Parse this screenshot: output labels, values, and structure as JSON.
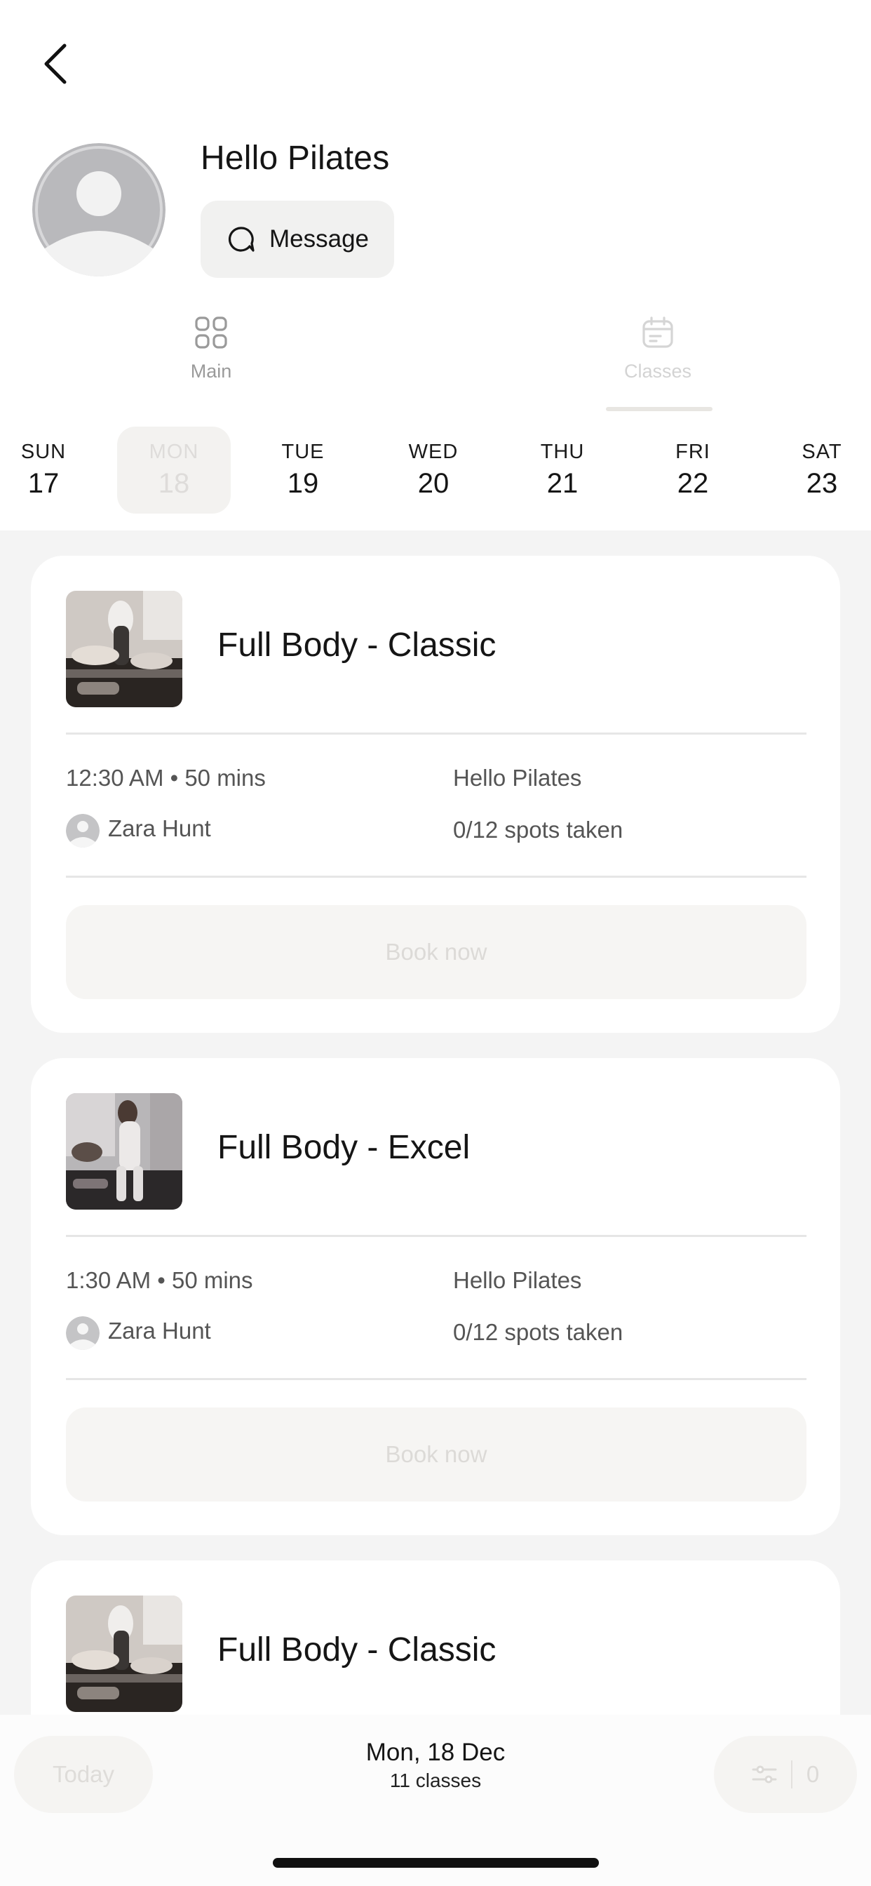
{
  "header": {
    "studio_name": "Hello Pilates",
    "message_label": "Message"
  },
  "tabs": [
    {
      "label": "Main",
      "icon": "grid-icon",
      "active": false
    },
    {
      "label": "Classes",
      "icon": "calendar-icon",
      "active": true
    }
  ],
  "days": [
    {
      "name": "SUN",
      "date": "17",
      "selected": false
    },
    {
      "name": "MON",
      "date": "18",
      "selected": true
    },
    {
      "name": "TUE",
      "date": "19",
      "selected": false
    },
    {
      "name": "WED",
      "date": "20",
      "selected": false
    },
    {
      "name": "THU",
      "date": "21",
      "selected": false
    },
    {
      "name": "FRI",
      "date": "22",
      "selected": false
    },
    {
      "name": "SAT",
      "date": "23",
      "selected": false
    }
  ],
  "classes": [
    {
      "title": "Full Body - Classic",
      "time": "12:30 AM • 50 mins",
      "instructor": "Zara Hunt",
      "location": "Hello Pilates",
      "spots": "0/12 spots taken",
      "book_label": "Book now"
    },
    {
      "title": "Full Body - Excel",
      "time": "1:30 AM • 50 mins",
      "instructor": "Zara Hunt",
      "location": "Hello Pilates",
      "spots": "0/12 spots taken",
      "book_label": "Book now"
    },
    {
      "title": "Full Body - Classic"
    }
  ],
  "footer": {
    "today_label": "Today",
    "date_label": "Mon, 18 Dec",
    "count_label": "11 classes",
    "filter_count": "0"
  },
  "colors": {
    "background": "#f4f4f4",
    "card": "#ffffff",
    "muted_button": "#f6f5f3",
    "muted_text": "#dcdad7",
    "text": "#151515"
  }
}
